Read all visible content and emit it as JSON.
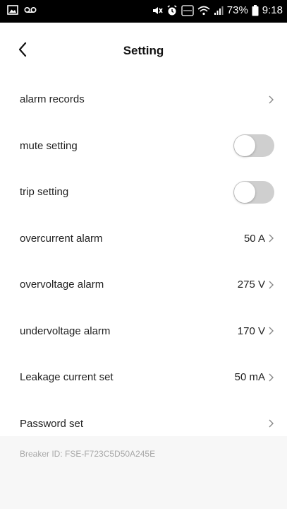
{
  "status_bar": {
    "battery": "73%",
    "time": "9:18",
    "icons": [
      "image-icon",
      "voicemail-icon",
      "mute-icon",
      "alarm-icon",
      "volte-icon",
      "wifi-icon",
      "signal-icon",
      "battery-icon"
    ]
  },
  "header": {
    "title": "Setting",
    "back_icon": "chevron-left-icon"
  },
  "settings": {
    "alarm_records": {
      "label": "alarm records"
    },
    "mute_setting": {
      "label": "mute setting",
      "enabled": false
    },
    "trip_setting": {
      "label": "trip setting",
      "enabled": false
    },
    "overcurrent_alarm": {
      "label": "overcurrent alarm",
      "value": "50 A"
    },
    "overvoltage_alarm": {
      "label": "overvoltage alarm",
      "value": "275 V"
    },
    "undervoltage_alarm": {
      "label": "undervoltage alarm",
      "value": "170 V"
    },
    "leakage_current": {
      "label": "Leakage current set",
      "value": "50 mA"
    },
    "password_set": {
      "label": "Password set"
    }
  },
  "footer": {
    "breaker_id": "Breaker ID: FSE-F723C5D50A245E"
  },
  "colors": {
    "toggle_off": "#cfcfcf",
    "footer_bg": "#f7f7f7",
    "muted_text": "#a8a8a8"
  }
}
